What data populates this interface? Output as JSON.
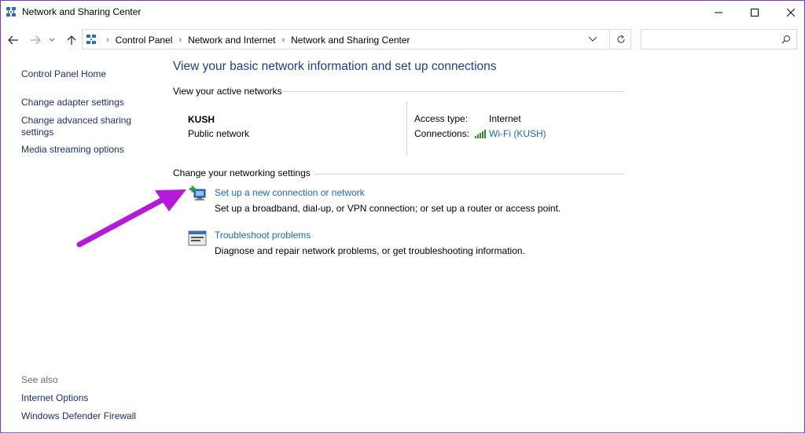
{
  "window": {
    "title": "Network and Sharing Center",
    "controls": {
      "minimize": "minimize",
      "maximize": "maximize",
      "close": "close"
    }
  },
  "address_bar": {
    "breadcrumbs": [
      "Control Panel",
      "Network and Internet",
      "Network and Sharing Center"
    ],
    "search_placeholder": ""
  },
  "left_pane": {
    "home": "Control Panel Home",
    "links": [
      "Change adapter settings",
      "Change advanced sharing settings",
      "Media streaming options"
    ],
    "see_also_label": "See also",
    "see_also": [
      "Internet Options",
      "Windows Defender Firewall"
    ]
  },
  "main": {
    "title": "View your basic network information and set up connections",
    "active_networks_heading": "View your active networks",
    "network": {
      "name": "KUSH",
      "category": "Public network",
      "access_type_label": "Access type:",
      "access_type_value": "Internet",
      "connections_label": "Connections:",
      "connections_value": "Wi-Fi (KUSH)"
    },
    "change_settings_heading": "Change your networking settings",
    "tasks": [
      {
        "icon": "new-connection-icon",
        "title": "Set up a new connection or network",
        "description": "Set up a broadband, dial-up, or VPN connection; or set up a router or access point."
      },
      {
        "icon": "troubleshoot-icon",
        "title": "Troubleshoot problems",
        "description": "Diagnose and repair network problems, or get troubleshooting information."
      }
    ]
  },
  "annotation": {
    "arrow_color": "#b61ad9"
  },
  "colors": {
    "heading_blue": "#1e3f8c",
    "link_blue": "#1e66b8",
    "window_border": "#7a39c6"
  }
}
